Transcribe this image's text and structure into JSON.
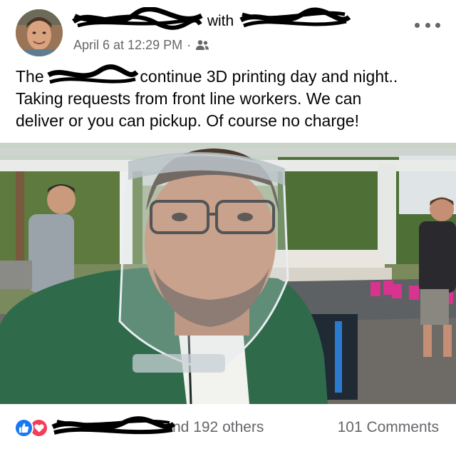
{
  "post": {
    "author_with": "with",
    "date": "April 6 at 12:29 PM",
    "separator": "·",
    "audience_icon": "friends-icon",
    "more_icon": "more-options-icon",
    "text_lines": [
      [
        "The ",
        "continue 3D printing day and night.."
      ],
      "Taking requests from front line workers. We can",
      "deliver or you can pickup. Of course no charge!"
    ],
    "line1_prefix": "The",
    "line1_suffix": "continue 3D printing day and night..",
    "line2": "Taking requests from front line workers. We can",
    "line3": "deliver or you can pickup. Of course no charge!"
  },
  "reactions": {
    "icons": [
      "like-icon",
      "love-icon"
    ],
    "suffix": "nd 192 others",
    "comments": "101 Comments"
  },
  "colors": {
    "text": "#050505",
    "secondary": "#65676b",
    "like_blue": "#1877f2",
    "love_red": "#f33e58"
  }
}
